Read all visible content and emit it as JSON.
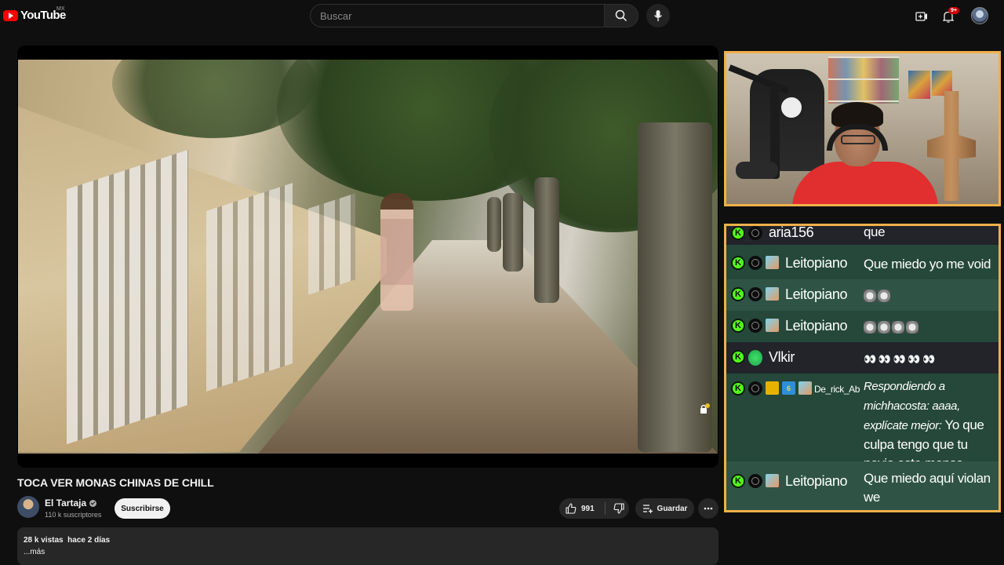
{
  "header": {
    "logo_text": "YouTube",
    "country_code": "MX",
    "search_placeholder": "Buscar",
    "notification_count": "9+",
    "icons": [
      "search-icon",
      "microphone-icon",
      "create-video-icon",
      "bell-icon",
      "account-avatar"
    ]
  },
  "video": {
    "title": "TOCA VER MONAS CHINAS DE CHILL",
    "channel_name": "El Tartaja",
    "subscribers": "110 k suscriptores",
    "subscribe_label": "Suscribirse",
    "like_count": "991",
    "save_label": "Guardar",
    "views": "28 k vistas",
    "date": "hace 2 días",
    "more_label": "...más"
  },
  "chat": {
    "messages": [
      {
        "user": "aria156",
        "text": "que",
        "badges": [
          "kick",
          "user"
        ]
      },
      {
        "user": "Leitopiano",
        "text": "Que miedo yo me void",
        "badges": [
          "kick",
          "user",
          "gift"
        ]
      },
      {
        "user": "Leitopiano",
        "text": "",
        "emotes": 2,
        "badges": [
          "kick",
          "user",
          "gift"
        ]
      },
      {
        "user": "Leitopiano",
        "text": "",
        "emotes": 4,
        "badges": [
          "kick",
          "user",
          "gift"
        ]
      },
      {
        "user": "Vlkir",
        "text": "",
        "eyes": 5,
        "badges": [
          "kick",
          "heart"
        ]
      },
      {
        "user": "De_rick_Ab",
        "reply_prefix": "Respondiendo a michhacosta: aaaa, explícate mejor:",
        "text": "Yo que culpa tengo que tu novio este menso",
        "badges": [
          "kick",
          "user",
          "crown",
          "sub",
          "gift"
        ]
      },
      {
        "user": "Leitopiano",
        "text": "Que miedo aquí violan we",
        "badges": [
          "kick",
          "user",
          "gift"
        ]
      }
    ]
  },
  "colors": {
    "accent_border": "#f0b04a",
    "chat_bg": "#25483a",
    "kick_green": "#53fc18",
    "youtube_red": "#ff0000"
  }
}
